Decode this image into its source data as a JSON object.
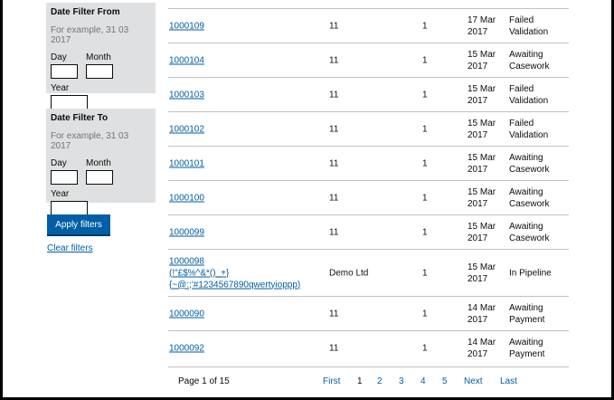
{
  "filters": {
    "from": {
      "title": "Date Filter From",
      "hint": "For example, 31 03 2017",
      "day_label": "Day",
      "month_label": "Month",
      "year_label": "Year",
      "day_value": "",
      "month_value": "",
      "year_value": ""
    },
    "to": {
      "title": "Date Filter To",
      "hint": "For example, 31 03 2017",
      "day_label": "Day",
      "month_label": "Month",
      "year_label": "Year",
      "day_value": "",
      "month_value": "",
      "year_value": ""
    },
    "apply_label": "Apply filters",
    "clear_label": "Clear filters"
  },
  "rows": [
    {
      "id": "1000109",
      "org": "11",
      "count": "1",
      "date": [
        "17 Mar",
        "2017"
      ],
      "status": [
        "Failed",
        "Validation"
      ]
    },
    {
      "id": "1000104",
      "org": "11",
      "count": "1",
      "date": [
        "15 Mar",
        "2017"
      ],
      "status": [
        "Awaiting",
        "Casework"
      ]
    },
    {
      "id": "1000103",
      "org": "11",
      "count": "1",
      "date": [
        "15 Mar",
        "2017"
      ],
      "status": [
        "Failed",
        "Validation"
      ]
    },
    {
      "id": "1000102",
      "org": "11",
      "count": "1",
      "date": [
        "15 Mar",
        "2017"
      ],
      "status": [
        "Failed",
        "Validation"
      ]
    },
    {
      "id": "1000101",
      "org": "11",
      "count": "1",
      "date": [
        "15 Mar",
        "2017"
      ],
      "status": [
        "Awaiting",
        "Casework"
      ]
    },
    {
      "id": "1000100",
      "org": "11",
      "count": "1",
      "date": [
        "15 Mar",
        "2017"
      ],
      "status": [
        "Awaiting",
        "Casework"
      ]
    },
    {
      "id": "1000099",
      "org": "11",
      "count": "1",
      "date": [
        "15 Mar",
        "2017"
      ],
      "status": [
        "Awaiting",
        "Casework"
      ]
    },
    {
      "id": "1000098\n(!\"£$%^&*()_+}\n{~@:;'#1234567890qwertyioppp)",
      "org": "Demo Ltd",
      "count": "1",
      "date": [
        "15 Mar",
        "2017"
      ],
      "status": [
        "In Pipeline",
        ""
      ]
    },
    {
      "id": "1000090",
      "org": "11",
      "count": "1",
      "date": [
        "14 Mar",
        "2017"
      ],
      "status": [
        "Awaiting",
        "Payment"
      ]
    },
    {
      "id": "1000092",
      "org": "11",
      "count": "1",
      "date": [
        "14 Mar",
        "2017"
      ],
      "status": [
        "Awaiting",
        "Payment"
      ]
    }
  ],
  "pagination": {
    "info": "Page 1 of 15",
    "first": "First",
    "pages": [
      "1",
      "2",
      "3",
      "4",
      "5"
    ],
    "current": "1",
    "next": "Next",
    "last": "Last"
  }
}
